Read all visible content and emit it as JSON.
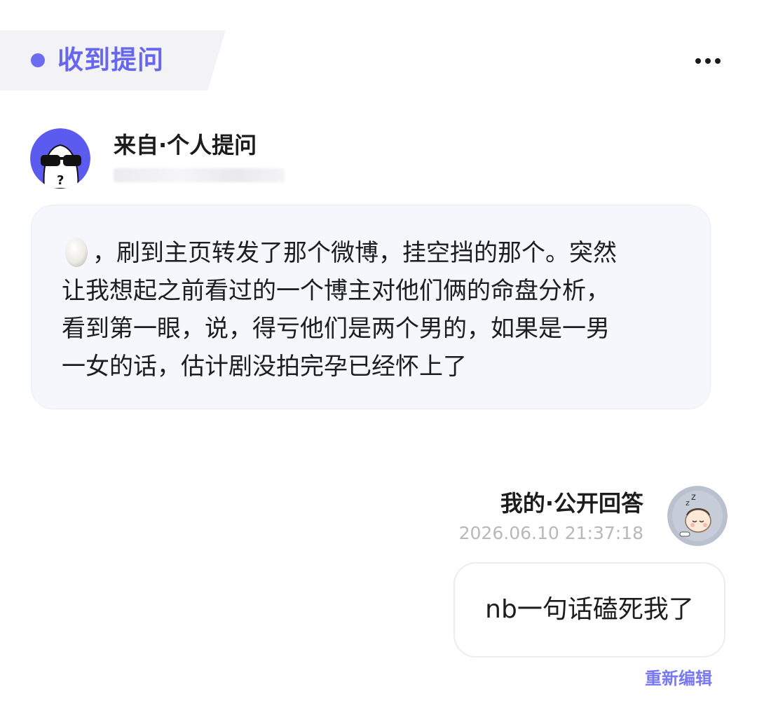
{
  "header": {
    "title": "收到提问",
    "accent_color": "#6666ee",
    "more_icon": "more-horizontal-icon"
  },
  "question": {
    "source_label": "来自·个人提问",
    "avatar_icon": "sunglasses-ghost-avatar",
    "emoji_icon": "egg-emoji",
    "text": "，刷到主页转发了那个微博，挂空挡的那个。突然\n让我想起之前看过的一个博主对他们俩的命盘分析，\n看到第一眼，说，得亏他们是两个男的，如果是一男\n一女的话，估计剧没拍完孕已经怀上了",
    "card_background": "#f5f7fd"
  },
  "answer": {
    "label": "我的·公开回答",
    "timestamp": "2026.06.10 21:37:18",
    "avatar_icon": "sleeping-character-avatar",
    "text": "nb一句话磕死我了",
    "reedit_label": "重新编辑",
    "link_color": "#7878f0"
  }
}
